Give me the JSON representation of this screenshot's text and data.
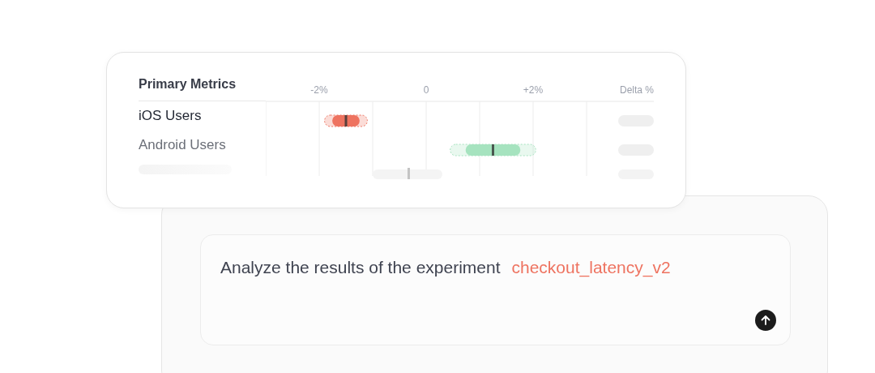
{
  "metrics_card": {
    "title": "Primary Metrics",
    "axis_labels": [
      "-2%",
      "0",
      "+2%"
    ],
    "delta_label": "Delta %",
    "rows": [
      {
        "label": "iOS Users",
        "muted": false,
        "color": "#ee7360"
      },
      {
        "label": "Android Users",
        "muted": true,
        "color": "#a6e3bf"
      }
    ]
  },
  "prompt": {
    "text": "Analyze the results of the experiment",
    "experiment": "checkout_latency_v2"
  }
}
